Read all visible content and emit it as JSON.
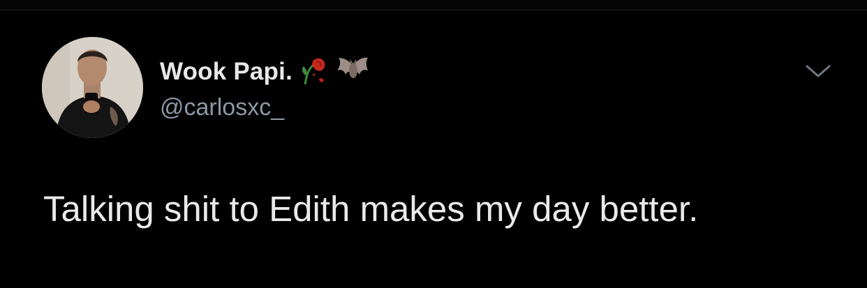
{
  "tweet": {
    "author": {
      "display_name": "Wook Papi.",
      "handle": "@carlosxc_",
      "name_emojis": [
        "wilted-rose-icon",
        "bat-icon"
      ]
    },
    "body": "Talking shit to Edith makes my day better."
  },
  "colors": {
    "background": "#000000",
    "name_text": "#e8e8e8",
    "handle_text": "#8b98a5",
    "body_text": "#eaeaea"
  }
}
